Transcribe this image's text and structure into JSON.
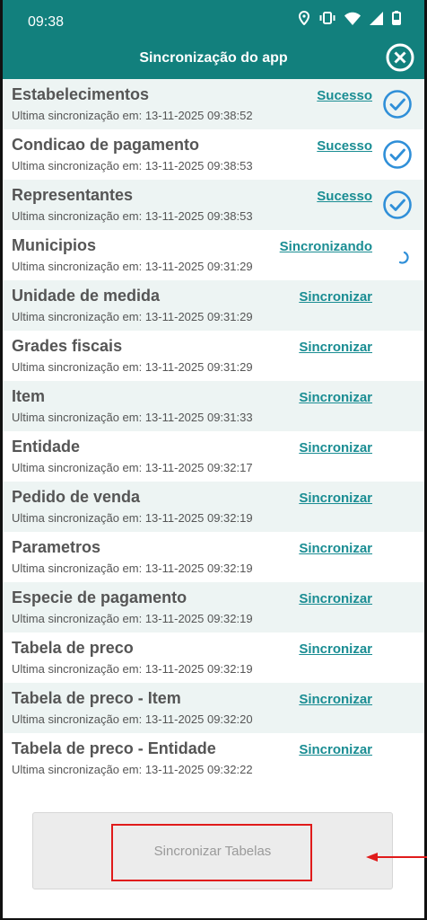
{
  "status_bar": {
    "time": "09:38"
  },
  "header": {
    "title": "Sincronização do app"
  },
  "rows": [
    {
      "name": "Estabelecimentos",
      "date": "Ultima sincronização em: 13-11-2025 09:38:52",
      "status": "Sucesso",
      "state": "success"
    },
    {
      "name": "Condicao de pagamento",
      "date": "Ultima sincronização em: 13-11-2025 09:38:53",
      "status": "Sucesso",
      "state": "success"
    },
    {
      "name": "Representantes",
      "date": "Ultima sincronização em: 13-11-2025 09:38:53",
      "status": "Sucesso",
      "state": "success"
    },
    {
      "name": "Municipios",
      "date": "Ultima sincronização em: 13-11-2025 09:31:29",
      "status": "Sincronizando",
      "state": "syncing"
    },
    {
      "name": "Unidade de medida",
      "date": "Ultima sincronização em: 13-11-2025 09:31:29",
      "status": "Sincronizar",
      "state": "idle"
    },
    {
      "name": "Grades fiscais",
      "date": "Ultima sincronização em: 13-11-2025 09:31:29",
      "status": "Sincronizar",
      "state": "idle"
    },
    {
      "name": "Item",
      "date": "Ultima sincronização em: 13-11-2025 09:31:33",
      "status": "Sincronizar",
      "state": "idle"
    },
    {
      "name": "Entidade",
      "date": "Ultima sincronização em: 13-11-2025 09:32:17",
      "status": "Sincronizar",
      "state": "idle"
    },
    {
      "name": "Pedido de venda",
      "date": "Ultima sincronização em: 13-11-2025 09:32:19",
      "status": "Sincronizar",
      "state": "idle"
    },
    {
      "name": "Parametros",
      "date": "Ultima sincronização em: 13-11-2025 09:32:19",
      "status": "Sincronizar",
      "state": "idle"
    },
    {
      "name": "Especie de pagamento",
      "date": "Ultima sincronização em: 13-11-2025 09:32:19",
      "status": "Sincronizar",
      "state": "idle"
    },
    {
      "name": "Tabela de preco",
      "date": "Ultima sincronização em: 13-11-2025 09:32:19",
      "status": "Sincronizar",
      "state": "idle"
    },
    {
      "name": "Tabela de preco - Item",
      "date": "Ultima sincronização em: 13-11-2025 09:32:20",
      "status": "Sincronizar",
      "state": "idle"
    },
    {
      "name": "Tabela de preco - Entidade",
      "date": "Ultima sincronização em: 13-11-2025 09:32:22",
      "status": "Sincronizar",
      "state": "idle"
    }
  ],
  "footer": {
    "sync_button_label": "Sincronizar Tabelas"
  },
  "colors": {
    "header": "#12807d",
    "link": "#1a8d93",
    "check": "#2f8fd8",
    "highlight": "#e01b1b"
  },
  "icons": [
    "location-icon",
    "vibrate-icon",
    "wifi-icon",
    "signal-icon",
    "battery-icon",
    "close-circle-icon",
    "check-circle-icon",
    "spinner-icon",
    "arrow-left-icon"
  ]
}
